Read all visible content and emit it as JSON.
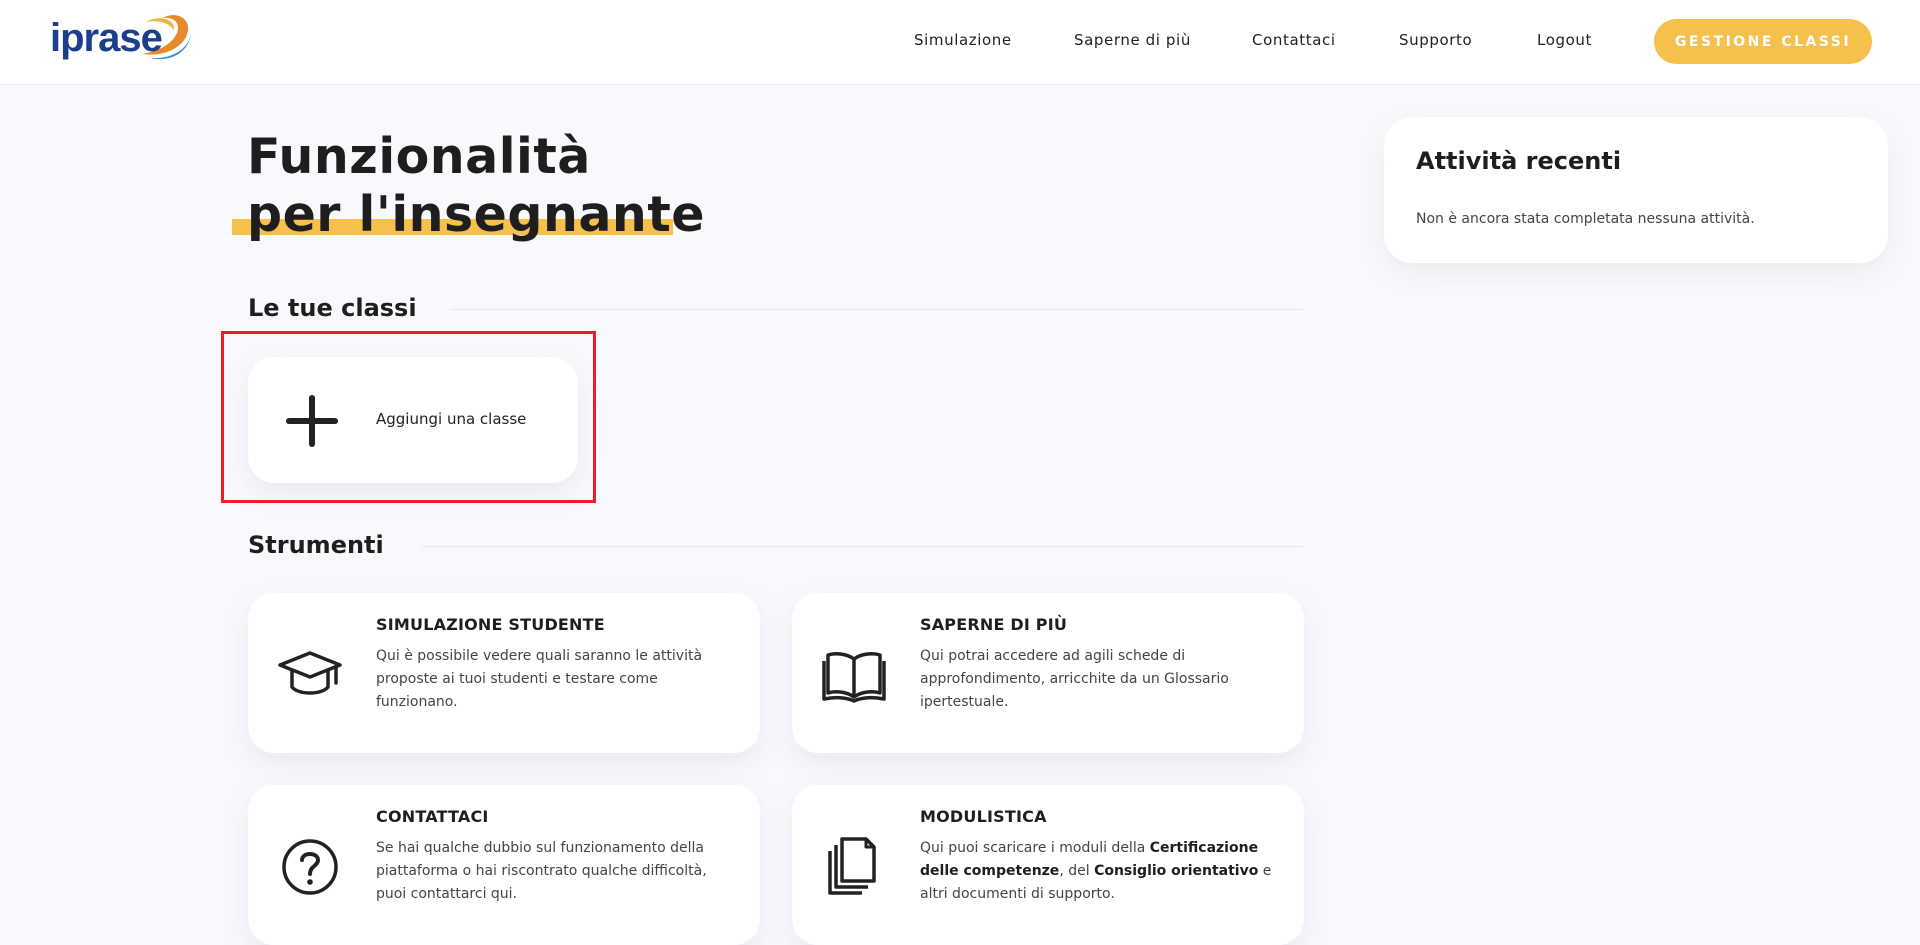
{
  "header": {
    "logo_text": "iprase",
    "nav": [
      {
        "label": "Simulazione"
      },
      {
        "label": "Saperne di più"
      },
      {
        "label": "Contattaci"
      },
      {
        "label": "Supporto"
      },
      {
        "label": "Logout"
      }
    ],
    "cta_label": "GESTIONE CLASSI"
  },
  "main": {
    "title_line1": "Funzionalità",
    "title_line2": "per l'insegnante",
    "classes": {
      "title": "Le tue classi",
      "add_label": "Aggiungi una classe",
      "add_icon": "plus-icon"
    },
    "tools": {
      "title": "Strumenti",
      "cards": [
        {
          "title": "SIMULAZIONE STUDENTE",
          "icon": "graduation-cap-icon",
          "text": "Qui è possibile vedere quali saranno le attività proposte ai tuoi studenti e testare come funzionano."
        },
        {
          "title": "SAPERNE DI PIÙ",
          "icon": "book-icon",
          "text": "Qui potrai accedere ad agili schede di approfondimento, arricchite da un Glossario ipertestuale."
        },
        {
          "title": "CONTATTACI",
          "icon": "question-circle-icon",
          "text": "Se hai qualche dubbio sul funzionamento della piattaforma o hai riscontrato qualche difficoltà, puoi contattarci qui."
        },
        {
          "title": "MODULISTICA",
          "icon": "documents-icon",
          "text_parts": [
            "Qui puoi scaricare i moduli della ",
            "Certificazione delle competenze",
            ", del ",
            "Consiglio orientativo",
            " e altri documenti di supporto."
          ]
        }
      ]
    }
  },
  "sidebar": {
    "recent_title": "Attività recenti",
    "recent_empty": "Non è ancora stata completata nessuna attività."
  },
  "colors": {
    "accent": "#f5c04c",
    "highlight_box": "#ee1c25",
    "logo_blue": "#1b3f8a",
    "logo_orange": "#e8892c"
  }
}
